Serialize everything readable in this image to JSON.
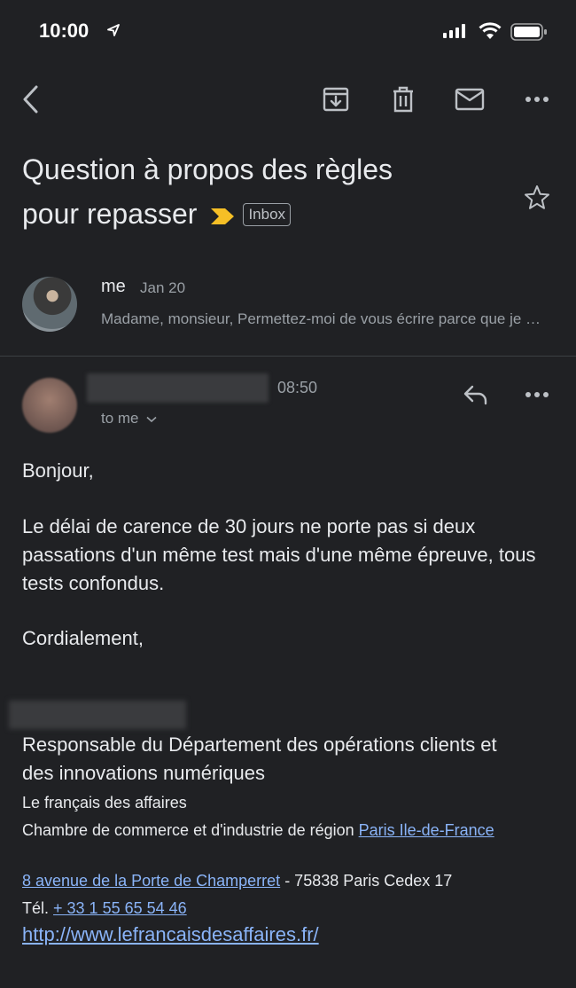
{
  "status_bar": {
    "time": "10:00"
  },
  "toolbar": {
    "back": "back-arrow-icon",
    "archive": "archive-icon",
    "delete": "trash-icon",
    "mark_unread": "mail-icon",
    "more": "more-horizontal-icon"
  },
  "email": {
    "subject_line1": "Question à propos des règles",
    "subject_line2": "pour repasser",
    "label": "Inbox",
    "importance_color": "#f6bf26"
  },
  "collapsed_message": {
    "sender": "me",
    "date": "Jan 20",
    "snippet": "Madame, monsieur, Permettez-moi de vous écrire parce que je ne trouve pas"
  },
  "open_message": {
    "time": "08:50",
    "recipient": "to me",
    "greeting": "Bonjour,",
    "body": "Le délai de carence de 30 jours ne porte pas si deux passations d'un même test mais d'une même épreuve, tous tests confondus.",
    "closing": "Cordialement,",
    "signature": {
      "role": "Responsable du Département des opérations clients et des innovations numériques",
      "org": "Le français des affaires",
      "chamber_prefix": "Chambre de commerce et d'industrie de région ",
      "chamber_link": "Paris Ile-de-France",
      "address_link": "8 avenue de la Porte de Champerret",
      "address_rest": " - 75838 Paris Cedex 17",
      "tel_label": "Tél. ",
      "tel_link": "+ 33 1 55 65 54 46",
      "website": "http://www.lefrancaisdesaffaires.fr/"
    }
  },
  "colors": {
    "background": "#202124",
    "link": "#8ab4f8",
    "secondary_text": "#9aa0a6"
  }
}
